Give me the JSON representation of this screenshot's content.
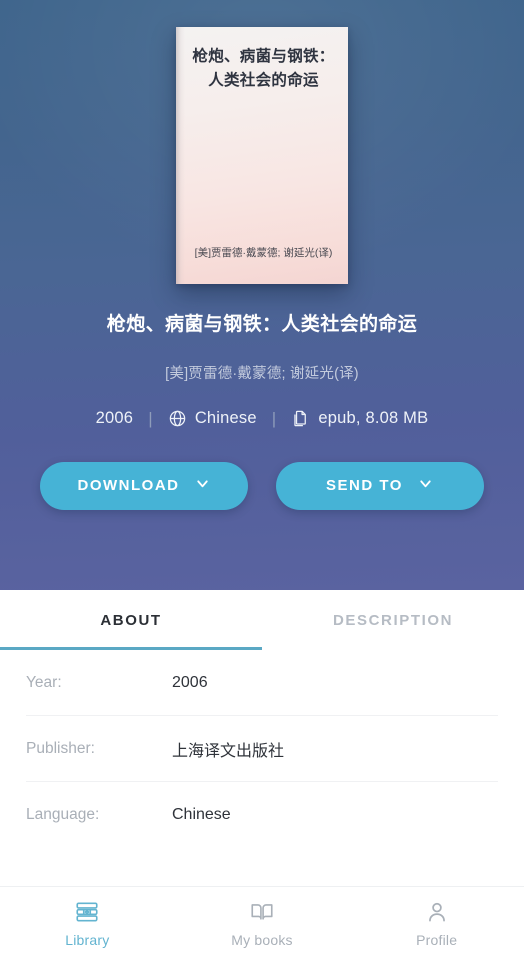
{
  "hero": {
    "cover": {
      "title": "枪炮、病菌与钢铁：人类社会的命运",
      "author": "[美]贾雷德·戴蒙德; 谢延光(译)"
    },
    "book_title": "枪炮、病菌与钢铁：人类社会的命运",
    "book_author": "[美]贾雷德·戴蒙德; 谢延光(译)",
    "meta": {
      "year": "2006",
      "separator": "|",
      "language": "Chinese",
      "language_icon": "globe-icon",
      "file": "epub, 8.08 MB",
      "file_icon": "document-icon"
    },
    "buttons": {
      "download_label": "DOWNLOAD",
      "sendto_label": "SEND TO",
      "chevron_icon": "chevron-down-icon"
    },
    "colors": {
      "gradient_top": "#3f658c",
      "gradient_bottom": "#5a63a0",
      "button": "#46b3d6"
    }
  },
  "tabs": {
    "items": [
      {
        "label": "ABOUT",
        "active": true
      },
      {
        "label": "DESCRIPTION",
        "active": false
      }
    ],
    "underline_color": "#5aa8c4"
  },
  "details": {
    "rows": [
      {
        "label": "Year:",
        "value": "2006"
      },
      {
        "label": "Publisher:",
        "value": "上海译文出版社"
      },
      {
        "label": "Language:",
        "value": "Chinese"
      }
    ]
  },
  "bottom_nav": {
    "items": [
      {
        "label": "Library",
        "icon": "books-stack-icon",
        "active": true
      },
      {
        "label": "My books",
        "icon": "open-book-icon",
        "active": false
      },
      {
        "label": "Profile",
        "icon": "person-icon",
        "active": false
      }
    ],
    "active_color": "#63b4d0",
    "idle_color": "#a9b0b8"
  }
}
